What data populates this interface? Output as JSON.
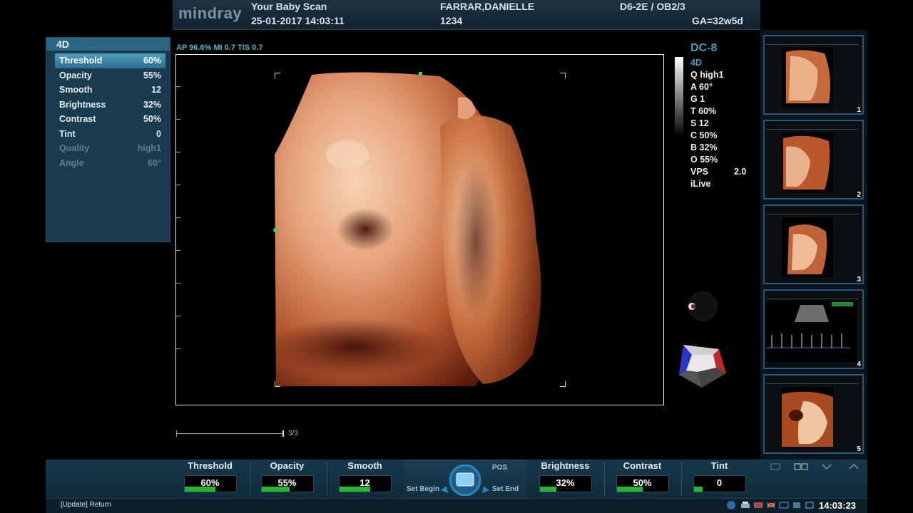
{
  "header": {
    "brand": "mindray",
    "exam_title": "Your Baby Scan",
    "datetime": "25-01-2017  14:03:11",
    "patient_name": "FARRAR,DANIELLE",
    "patient_id": "1234",
    "probe_preset": "D6-2E / OB2/3",
    "ga": "GA=32w5d"
  },
  "left_panel": {
    "title": "4D",
    "params": [
      {
        "label": "Threshold",
        "value": "60%",
        "state": "selected"
      },
      {
        "label": "Opacity",
        "value": "55%",
        "state": "normal"
      },
      {
        "label": "Smooth",
        "value": "12",
        "state": "normal"
      },
      {
        "label": "Brightness",
        "value": "32%",
        "state": "normal"
      },
      {
        "label": "Contrast",
        "value": "50%",
        "state": "normal"
      },
      {
        "label": "Tint",
        "value": "0",
        "state": "normal"
      },
      {
        "label": "Quality",
        "value": "high1",
        "state": "disabled"
      },
      {
        "label": "Angle",
        "value": "60°",
        "state": "disabled"
      }
    ]
  },
  "image": {
    "top_readout": "AP 96.6%  MI 0.7  TIS 0.7",
    "cine_position": "3/3"
  },
  "right_readout": {
    "probe": "DC-8",
    "mode": "4D",
    "lines": [
      "Q high1",
      "A 60°",
      "G 1",
      "T 60%",
      "S 12",
      "C 50%",
      "B 32%",
      "O 55%"
    ],
    "vps_label": "VPS",
    "vps_value": "2.0",
    "ilive": "iLive"
  },
  "thumbnails": [
    {
      "number": "1"
    },
    {
      "number": "2"
    },
    {
      "number": "3"
    },
    {
      "number": "4"
    },
    {
      "number": "5"
    }
  ],
  "bottom_controls": [
    {
      "label": "Threshold",
      "value": "60%",
      "level": 0.6
    },
    {
      "label": "Opacity",
      "value": "55%",
      "level": 0.55
    },
    {
      "label": "Smooth",
      "value": "12",
      "level": 0.6
    },
    {
      "label": "Brightness",
      "value": "32%",
      "level": 0.32
    },
    {
      "label": "Contrast",
      "value": "50%",
      "level": 0.5
    },
    {
      "label": "Tint",
      "value": "0",
      "level": 0.18
    }
  ],
  "center_control": {
    "pos_label": "POS",
    "set_begin": "Set Begin",
    "set_end": "Set End"
  },
  "status": {
    "hint": "[Update] Return",
    "clock": "14:03:23"
  },
  "colors": {
    "accent": "#3f9ebf",
    "panel": "#1a3b4e",
    "selected": "#2a7094",
    "level_fill": "#26b62c"
  }
}
